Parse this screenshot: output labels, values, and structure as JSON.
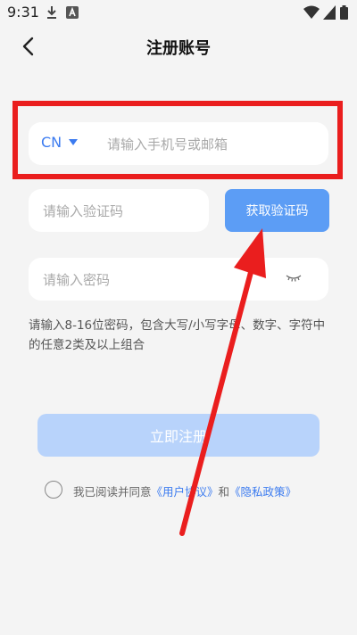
{
  "status_bar": {
    "time": "9:31"
  },
  "header": {
    "title": "注册账号"
  },
  "phone": {
    "country_code": "CN",
    "placeholder": "请输入手机号或邮箱"
  },
  "verification": {
    "placeholder": "请输入验证码",
    "button_label": "获取验证码"
  },
  "password": {
    "placeholder": "请输入密码"
  },
  "hint": "请输入8-16位密码，包含大写/小写字母、数字、字符中的任意2类及以上组合",
  "register": {
    "label": "立即注册"
  },
  "agreement": {
    "prefix": "我已阅读并同意",
    "user_agreement": "《用户协议》",
    "and": "和",
    "privacy_policy": "《隐私政策》"
  },
  "colors": {
    "accent": "#3b7bf0",
    "button": "#5c9df5",
    "disabled_button": "#b8d3fb",
    "annotation": "#ea1e1e"
  },
  "icons": [
    "download-icon",
    "a-icon",
    "wifi-icon",
    "signal-icon",
    "battery-icon",
    "back-arrow-icon",
    "eye-closed-icon",
    "chevron-down-icon"
  ]
}
